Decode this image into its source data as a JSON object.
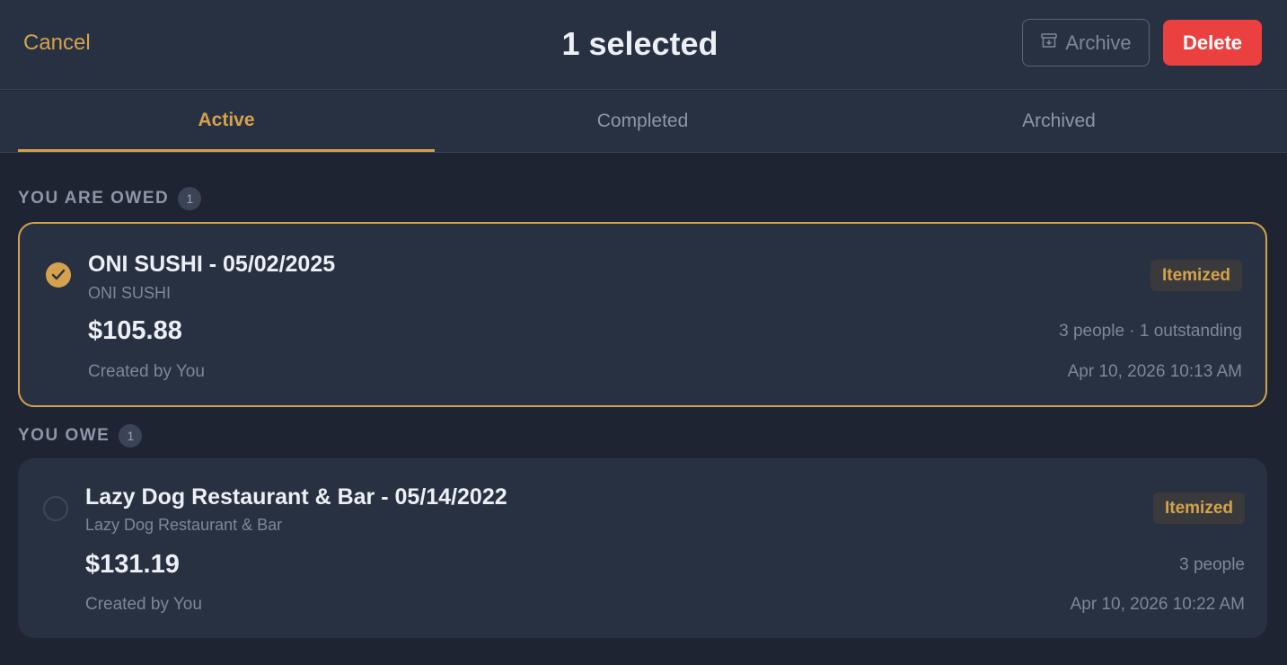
{
  "header": {
    "cancel_label": "Cancel",
    "title": "1 selected",
    "archive_label": "Archive",
    "delete_label": "Delete"
  },
  "tabs": [
    {
      "label": "Active",
      "active": true
    },
    {
      "label": "Completed",
      "active": false
    },
    {
      "label": "Archived",
      "active": false
    }
  ],
  "sections": [
    {
      "label": "YOU ARE OWED",
      "count": "1",
      "bills": [
        {
          "title": "ONI SUSHI - 05/02/2025",
          "merchant": "ONI SUSHI",
          "amount": "$105.88",
          "created_by": "Created by You",
          "badge": "Itemized",
          "people": "3 people · 1 outstanding",
          "date": "Apr 10, 2026 10:13 AM",
          "selected": true
        }
      ]
    },
    {
      "label": "YOU OWE",
      "count": "1",
      "bills": [
        {
          "title": "Lazy Dog Restaurant & Bar - 05/14/2022",
          "merchant": "Lazy Dog Restaurant & Bar",
          "amount": "$131.19",
          "created_by": "Created by You",
          "badge": "Itemized",
          "people": "3 people",
          "date": "Apr 10, 2026 10:22 AM",
          "selected": false
        }
      ]
    }
  ],
  "colors": {
    "accent": "#d4a24c",
    "danger": "#ea4040",
    "background": "#1f2433",
    "surface": "#283142"
  }
}
